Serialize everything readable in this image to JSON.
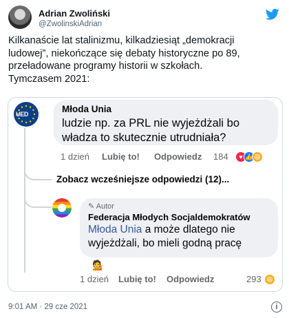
{
  "tweet": {
    "author_name": "Adrian Zwoliński",
    "author_handle": "@ZwolinskiAdrian",
    "text_lines": [
      "Kilkanaście lat stalinizmu, kilkadziesiąt „demokracji",
      "ludowej”, niekończące się debaty historyczne po 89,",
      "przeładowane programy historii w szkołach.",
      "Tymczasem 2021:"
    ],
    "timestamp": "9:01 AM · 29 cze 2021",
    "info_icon_label": "i"
  },
  "embed": {
    "comment1": {
      "avatar_text": "UED",
      "name": "Młoda Unia",
      "text_lines": [
        "ludzie np. za PRL nie wyjeżdżali bo",
        "władza to skutecznie utrudniała?"
      ],
      "time": "1 dzień",
      "like_label": "Lubię to!",
      "reply_label": "Odpowiedz",
      "reaction_count": "184"
    },
    "more_replies": "Zobacz wcześniejsze odpowiedzi (12)...",
    "comment2": {
      "author_badge": "Autor",
      "name": "Federacja Młodych Socjaldemokratów",
      "mention": "Młoda Unia",
      "text_after_mention": " a może dlatego nie",
      "text_line2": "wyjeżdżali, bo mieli godną pracę",
      "emoji": "💁",
      "time": "1 dzień",
      "like_label": "Lubię to!",
      "reply_label": "Odpowiedz",
      "reaction_count": "293"
    }
  },
  "colors": {
    "twitter_blue": "#1d9bf0",
    "fb_like_blue": "#1877f2",
    "love_red": "#f02849",
    "haha_yellow": "#f7b125",
    "mention_blue": "#385898"
  }
}
